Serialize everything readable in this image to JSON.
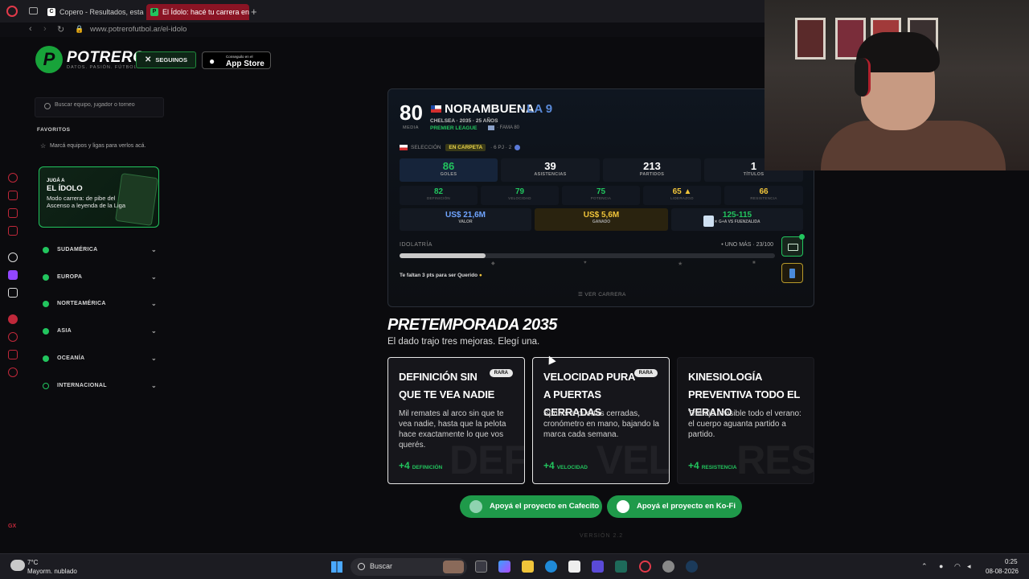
{
  "browser": {
    "tabs": [
      {
        "label": "Copero - Resultados, estad",
        "active": false
      },
      {
        "label": "El Ídolo: hacé tu carrera en",
        "active": true
      }
    ],
    "new_tab": "+",
    "url": "www.potrerofutbol.ar/el-idolo"
  },
  "header": {
    "logo_mark": "P",
    "logo_word": "POTRERO",
    "logo_tag": "DATOS. PASIÓN. FÚTBOL.",
    "follow_label": "SEGUINOS",
    "follow_icon": "x-logo-icon",
    "appstore_small": "Conseguilo en el",
    "appstore_big": "App Store"
  },
  "sidebar": {
    "search_placeholder": "Buscar equipo, jugador o torneo",
    "favorites_title": "FAVORITOS",
    "favorites_empty": "Marcá equipos y ligas para verlos acá.",
    "promo": {
      "small": "JUGÁ A",
      "big": "EL ÍDOLO",
      "desc": "Modo carrera: de pibe del Ascenso a leyenda de la Liga"
    },
    "regions": [
      "SUDAMÉRICA",
      "EUROPA",
      "NORTEAMÉRICA",
      "ASIA",
      "OCEANÍA",
      "INTERNACIONAL"
    ]
  },
  "player": {
    "rating": "80",
    "rating_label": "MEDIA",
    "name": "NORAMBUENA",
    "nick": "· LA 9",
    "meta": "CHELSEA · 2035 · 25 AÑOS",
    "league": "PREMIER LEAGUE",
    "fame": "· FAMA 80",
    "selection_label": "SELECCIÓN",
    "selection_badge": "EN CARPETA",
    "selection_extra": "· 6 PJ · 2",
    "stats": [
      {
        "value": "86",
        "label": "GOLES"
      },
      {
        "value": "39",
        "label": "ASISTENCIAS"
      },
      {
        "value": "213",
        "label": "PARTIDOS"
      },
      {
        "value": "1",
        "label": "TÍTULOS"
      }
    ],
    "attributes": [
      {
        "value": "82",
        "label": "DEFINICIÓN"
      },
      {
        "value": "79",
        "label": "VELOCIDAD"
      },
      {
        "value": "75",
        "label": "POTENCIA"
      },
      {
        "value": "65 ▲",
        "label": "LIDERAZGO"
      },
      {
        "value": "66",
        "label": "RESISTENCIA"
      }
    ],
    "money": [
      {
        "value": "US$ 21,6M",
        "label": "VALOR"
      },
      {
        "value": "US$ 5,6M",
        "label": "GANADO"
      },
      {
        "value": "125-115",
        "label": "✕ G+A VS FUENZALIDA"
      }
    ],
    "idolatria_label": "IDOLATRÍA",
    "idolatria_level": "• UNO MÁS · 23/100",
    "idolatria_progress": 0.23,
    "idolatria_hint": "Te faltan 3 pts para ser Querido",
    "ver_carrera": "☰ VER CARRERA"
  },
  "preseason": {
    "title": "PRETEMPORADA 2035",
    "subtitle": "El dado trajo tres mejoras. Elegí una.",
    "cards": [
      {
        "title": "DEFINICIÓN SIN QUE TE VEA NADIE",
        "badge": "RARA",
        "desc": "Mil remates al arco sin que te vea nadie, hasta que la pelota hace exactamente lo que vos querés.",
        "plus": "+4",
        "attr": "DEFINICIÓN",
        "ghost": "DEF"
      },
      {
        "title": "VELOCIDAD PURA A PUERTAS CERRADAS",
        "badge": "RARA",
        "desc": "Sprints a puertas cerradas, cronómetro en mano, bajando la marca cada semana.",
        "plus": "+4",
        "attr": "VELOCIDAD",
        "ghost": "VEL"
      },
      {
        "title": "KINESIOLOGÍA PREVENTIVA TODO EL VERANO",
        "badge": "",
        "desc": "Trabajo invisible todo el verano: el cuerpo aguanta partido a partido.",
        "plus": "+4",
        "attr": "RESISTENCIA",
        "ghost": "RES"
      }
    ]
  },
  "support": {
    "cafecito": "Apoyá el proyecto en Cafecito",
    "kofi": "Apoyá el proyecto en Ko-Fi"
  },
  "version": "VERSIÓN 2.2",
  "taskbar": {
    "weather_temp": "7°C",
    "weather_desc": "Mayorm. nublado",
    "search": "Buscar",
    "time": "0:25",
    "date": "08-08-2026"
  },
  "colors": {
    "accent_green": "#22c55e",
    "tab_active": "#8a1424",
    "nick_blue": "#5a8ad8",
    "gold": "#f0c43a"
  }
}
